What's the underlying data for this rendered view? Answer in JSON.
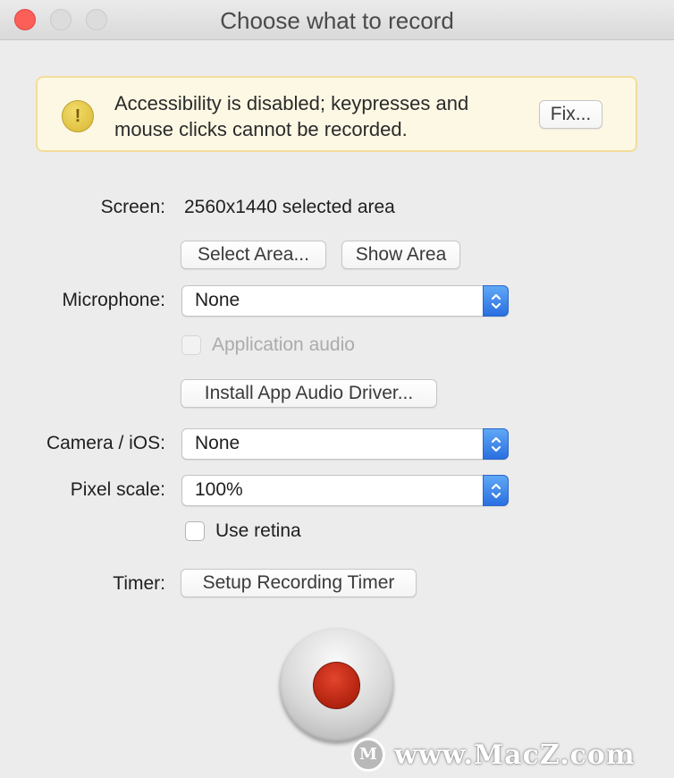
{
  "window": {
    "title": "Choose what to record"
  },
  "alert": {
    "icon": "warning-icon",
    "icon_glyph": "!",
    "message_line1": "Accessibility is disabled; keypresses and",
    "message_line2": "mouse clicks cannot be recorded.",
    "fix_label": "Fix..."
  },
  "screen": {
    "label": "Screen:",
    "value": "2560x1440 selected area",
    "select_area_label": "Select Area...",
    "show_area_label": "Show Area"
  },
  "microphone": {
    "label": "Microphone:",
    "selected": "None",
    "app_audio_label": "Application audio",
    "app_audio_checked": false,
    "app_audio_enabled": false,
    "install_driver_label": "Install App Audio Driver..."
  },
  "camera": {
    "label": "Camera / iOS:",
    "selected": "None"
  },
  "pixel_scale": {
    "label": "Pixel scale:",
    "selected": "100%",
    "use_retina_label": "Use retina",
    "use_retina_checked": false
  },
  "timer": {
    "label": "Timer:",
    "button_label": "Setup Recording Timer"
  },
  "record_button": {
    "icon": "record-icon"
  },
  "watermark": {
    "logo_glyph": "M",
    "text": "www.MacZ.com"
  },
  "colors": {
    "accent": "#2a6fe0",
    "record": "#c0281a",
    "alert_background": "#fdf8e4",
    "alert_border": "#f2dd9a"
  }
}
